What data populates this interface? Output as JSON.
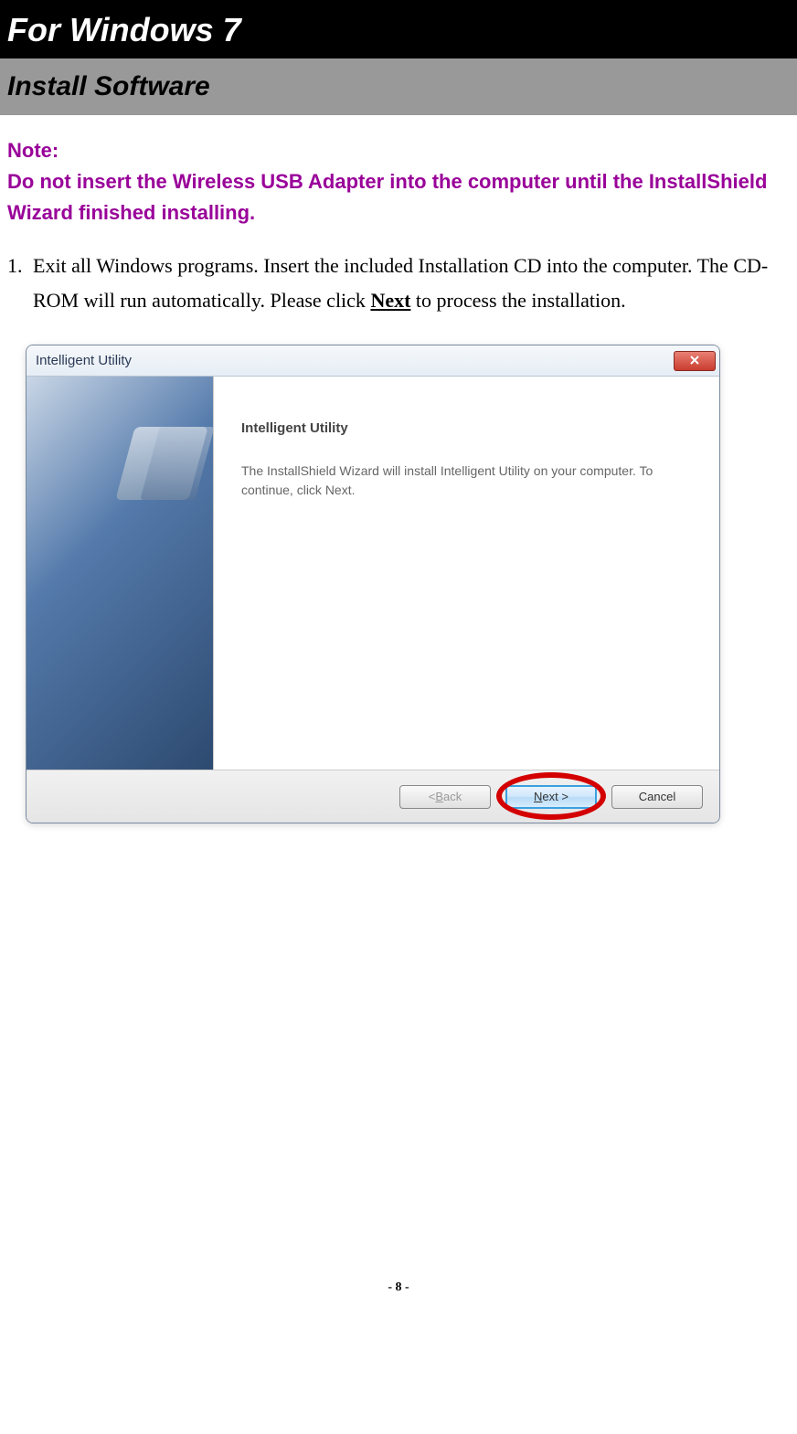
{
  "page": {
    "main_heading": "For Windows 7",
    "sub_heading": "Install Software",
    "page_number": "- 8 -"
  },
  "note": {
    "title": "Note:",
    "body": "Do not insert the Wireless USB Adapter into the computer until the InstallShield Wizard finished installing."
  },
  "step1": {
    "num": "1.",
    "text_before": "Exit all Windows programs. Insert the included Installation CD into the computer. The CD-ROM will run automatically. Please click ",
    "bold": "Next",
    "text_after": " to process the installation."
  },
  "dialog": {
    "title": "Intelligent Utility",
    "content_title": "Intelligent Utility",
    "content_text": "The InstallShield Wizard will install Intelligent Utility on your computer.  To continue, click Next.",
    "back_label_prefix": "< ",
    "back_key": "B",
    "back_label_rest": "ack",
    "next_label_prefix": "",
    "next_key": "N",
    "next_label_rest": "ext >",
    "cancel_label": "Cancel"
  }
}
